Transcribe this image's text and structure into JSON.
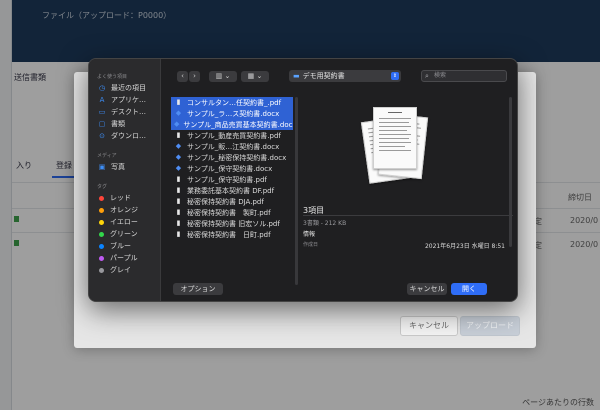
{
  "background": {
    "topbar_text": "ファイル（アップロード：P0000）",
    "side_label": "送信書類",
    "tabs": [
      "入り",
      "登録"
    ],
    "right_col_header": "締切日",
    "right_col_rows": [
      "2020/0",
      "2020/0"
    ],
    "mid_col_rows": [
      "設定",
      "設定"
    ],
    "bottom_text": "ページあたりの行数"
  },
  "upload_modal": {
    "cancel_label": "キャンセル",
    "upload_label": "アップロード"
  },
  "file_dialog": {
    "sidebar": {
      "favorites_heading": "よく使う項目",
      "favorites": [
        {
          "icon": "clock-icon",
          "glyph": "◷",
          "label": "最近の項目"
        },
        {
          "icon": "apps-icon",
          "glyph": "A",
          "label": "アプリケ…"
        },
        {
          "icon": "desktop-icon",
          "glyph": "▭",
          "label": "デスクト…"
        },
        {
          "icon": "document-icon",
          "glyph": "▢",
          "label": "書類"
        },
        {
          "icon": "download-icon",
          "glyph": "⊙",
          "label": "ダウンロ…"
        }
      ],
      "media_heading": "メディア",
      "media": [
        {
          "icon": "photos-icon",
          "glyph": "▣",
          "label": "写真"
        }
      ],
      "tags_heading": "タグ",
      "tags": [
        {
          "label": "レッド",
          "color": "#ff453a"
        },
        {
          "label": "オレンジ",
          "color": "#ff9f0a"
        },
        {
          "label": "イエロー",
          "color": "#ffd60a"
        },
        {
          "label": "グリーン",
          "color": "#32d74b"
        },
        {
          "label": "ブルー",
          "color": "#0a84ff"
        },
        {
          "label": "パープル",
          "color": "#bf5af2"
        },
        {
          "label": "グレイ",
          "color": "#98989d"
        }
      ]
    },
    "toolbar": {
      "back": "‹",
      "forward": "›",
      "view_mode": "▥ ⌄",
      "group_mode": "▦ ⌄",
      "location": "デモ用契約書",
      "search_placeholder": "検索"
    },
    "files": [
      {
        "name": "コンサルタン…任契約書_.pdf",
        "type": "pdf",
        "selected": true
      },
      {
        "name": "サンプル_ラ…ス契約書.docx",
        "type": "docx",
        "selected": true
      },
      {
        "name": "サンプル_商品売買基本契約書.docx",
        "type": "docx",
        "selected": true
      },
      {
        "name": "サンプル_動産売買契約書.pdf",
        "type": "pdf",
        "selected": false
      },
      {
        "name": "サンプル_販…江契約書.docx",
        "type": "docx",
        "selected": false
      },
      {
        "name": "サンプル_秘密保持契約書.docx",
        "type": "docx",
        "selected": false
      },
      {
        "name": "サンプル_保守契約書.docx",
        "type": "docx",
        "selected": false
      },
      {
        "name": "サンプル_保守契約書.pdf",
        "type": "pdf",
        "selected": false
      },
      {
        "name": "業務委託基本契約書 DF.pdf",
        "type": "pdf",
        "selected": false
      },
      {
        "name": "秘密保持契約書 DJA.pdf",
        "type": "pdf",
        "selected": false
      },
      {
        "name": "秘密保持契約書　製町.pdf",
        "type": "pdf",
        "selected": false
      },
      {
        "name": "秘密保持契約書 旧宏ソル.pdf",
        "type": "pdf",
        "selected": false
      },
      {
        "name": "秘密保持契約書　日町.pdf",
        "type": "pdf",
        "selected": false
      }
    ],
    "preview": {
      "title": "3項目",
      "meta": "3書類 - 212 KB",
      "info_heading": "情報",
      "created_label": "作成日",
      "created_value": "2021年6月23日 水曜日 8:51"
    },
    "footer": {
      "options_label": "オプション",
      "cancel_label": "キャンセル",
      "open_label": "開く"
    }
  }
}
